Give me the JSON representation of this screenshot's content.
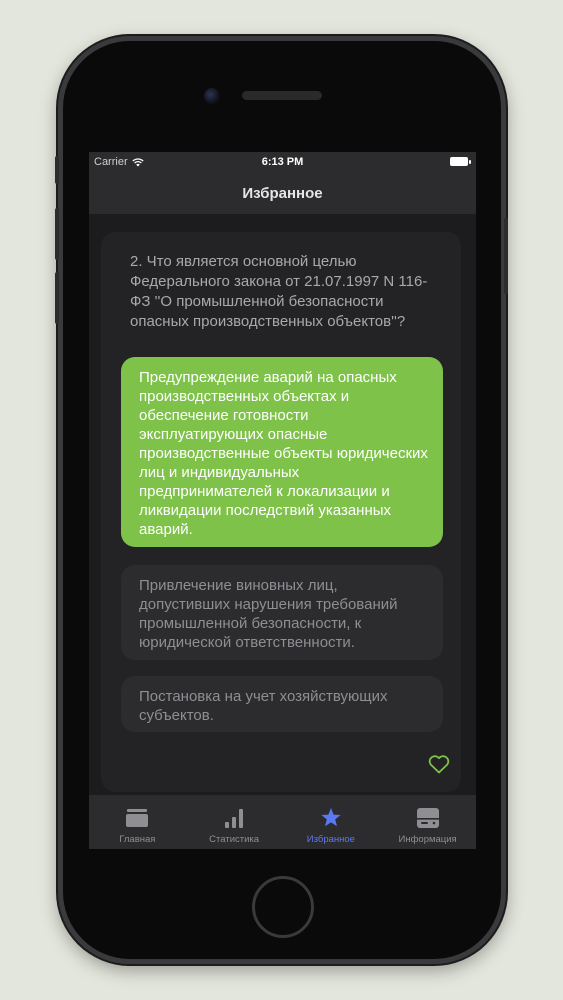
{
  "status_bar": {
    "carrier": "Carrier",
    "time": "6:13 PM"
  },
  "nav": {
    "title": "Избранное"
  },
  "question": {
    "text": "2. Что является основной целью Федерального закона от 21.07.1997 N 116-ФЗ ''О промышленной безопасности опасных производственных объектов''?"
  },
  "answers": [
    {
      "text": "Предупреждение аварий на опасных производственных объектах и обеспечение готовности эксплуатирующих опасные производственные объекты юридических лиц и индивидуальных предпринимателей к локализации и ликвидации последствий указанных аварий.",
      "correct": true
    },
    {
      "text": "Привлечение виновных лиц, допустивших нарушения требований промышленной безопасности, к юридической ответственности.",
      "correct": false
    },
    {
      "text": "Постановка на учет хозяйствующих субъектов.",
      "correct": false
    }
  ],
  "favorite_icon": "heart-outline-icon",
  "tabs": [
    {
      "label": "Главная",
      "icon": "card-icon",
      "active": false
    },
    {
      "label": "Статистика",
      "icon": "bar-chart-icon",
      "active": false
    },
    {
      "label": "Избранное",
      "icon": "star-icon",
      "active": true
    },
    {
      "label": "Информация",
      "icon": "info-box-icon",
      "active": false
    }
  ],
  "colors": {
    "correct_answer": "#7ec24a",
    "accent": "#5b79f0",
    "favorite": "#7ec24a",
    "screen_bg": "#1c1c1e",
    "bar_bg": "#2c2c2e"
  }
}
